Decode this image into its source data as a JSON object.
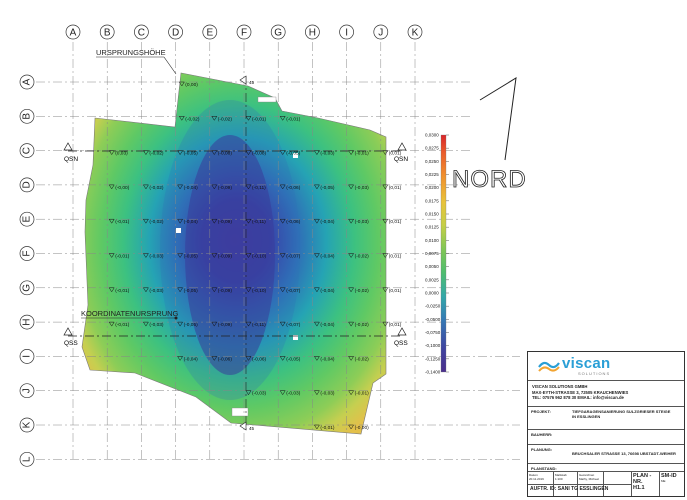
{
  "grid": {
    "columns": [
      "A",
      "B",
      "C",
      "D",
      "E",
      "F",
      "G",
      "H",
      "I",
      "J",
      "K"
    ],
    "rows": [
      "A",
      "B",
      "C",
      "D",
      "E",
      "F",
      "G",
      "H",
      "I",
      "J",
      "K",
      "L"
    ]
  },
  "labels": {
    "origin_height": "URSPRUNGSHÖHE",
    "origin_value": "(0,00)",
    "coord_origin": "KOORDINATENURSPRUNG",
    "north": "NORD",
    "section_n": "QSN",
    "section_s": "QSS",
    "section_cut": "45"
  },
  "heights": [
    {
      "v": "(0,00)",
      "c": 3.05,
      "r": 0
    },
    {
      "v": "(-0,02)",
      "c": 3.05,
      "r": 1
    },
    {
      "v": "(-0,02)",
      "c": 4,
      "r": 1
    },
    {
      "v": "(-0,01)",
      "c": 5,
      "r": 1
    },
    {
      "v": "(-0,01)",
      "c": 6,
      "r": 1
    },
    {
      "v": "(0,03)",
      "c": 1,
      "r": 2
    },
    {
      "v": "(-0,02)",
      "c": 2,
      "r": 2
    },
    {
      "v": "(-0,05)",
      "c": 3,
      "r": 2
    },
    {
      "v": "(-0,08)",
      "c": 4,
      "r": 2
    },
    {
      "v": "(-0,08)",
      "c": 5,
      "r": 2
    },
    {
      "v": "(-0,05)",
      "c": 6,
      "r": 2
    },
    {
      "v": "(-0,03)",
      "c": 7,
      "r": 2
    },
    {
      "v": "(-0,01)",
      "c": 8,
      "r": 2
    },
    {
      "v": "(0,01)",
      "c": 9,
      "r": 2
    },
    {
      "v": "(-0,00)",
      "c": 1,
      "r": 3
    },
    {
      "v": "(-0,02)",
      "c": 2,
      "r": 3
    },
    {
      "v": "(-0,04)",
      "c": 3,
      "r": 3
    },
    {
      "v": "(-0,09)",
      "c": 4,
      "r": 3
    },
    {
      "v": "(-0,11)",
      "c": 5,
      "r": 3
    },
    {
      "v": "(-0,06)",
      "c": 6,
      "r": 3
    },
    {
      "v": "(-0,05)",
      "c": 7,
      "r": 3
    },
    {
      "v": "(-0,03)",
      "c": 8,
      "r": 3
    },
    {
      "v": "(0,01)",
      "c": 9,
      "r": 3
    },
    {
      "v": "(-0,01)",
      "c": 1,
      "r": 4
    },
    {
      "v": "(-0,02)",
      "c": 2,
      "r": 4
    },
    {
      "v": "(-0,04)",
      "c": 3,
      "r": 4
    },
    {
      "v": "(-0,09)",
      "c": 4,
      "r": 4
    },
    {
      "v": "(-0,11)",
      "c": 5,
      "r": 4
    },
    {
      "v": "(-0,06)",
      "c": 6,
      "r": 4
    },
    {
      "v": "(-0,04)",
      "c": 7,
      "r": 4
    },
    {
      "v": "(-0,03)",
      "c": 8,
      "r": 4
    },
    {
      "v": "(0,01)",
      "c": 9,
      "r": 4
    },
    {
      "v": "(-0,01)",
      "c": 1,
      "r": 5
    },
    {
      "v": "(-0,03)",
      "c": 2,
      "r": 5
    },
    {
      "v": "(-0,05)",
      "c": 3,
      "r": 5
    },
    {
      "v": "(-0,09)",
      "c": 4,
      "r": 5
    },
    {
      "v": "(-0,10)",
      "c": 5,
      "r": 5
    },
    {
      "v": "(-0,07)",
      "c": 6,
      "r": 5
    },
    {
      "v": "(-0,04)",
      "c": 7,
      "r": 5
    },
    {
      "v": "(-0,02)",
      "c": 8,
      "r": 5
    },
    {
      "v": "(0,01)",
      "c": 9,
      "r": 5
    },
    {
      "v": "(-0,01)",
      "c": 1,
      "r": 6
    },
    {
      "v": "(-0,03)",
      "c": 2,
      "r": 6
    },
    {
      "v": "(-0,05)",
      "c": 3,
      "r": 6
    },
    {
      "v": "(-0,09)",
      "c": 4,
      "r": 6
    },
    {
      "v": "(-0,10)",
      "c": 5,
      "r": 6
    },
    {
      "v": "(-0,07)",
      "c": 6,
      "r": 6
    },
    {
      "v": "(-0,04)",
      "c": 7,
      "r": 6
    },
    {
      "v": "(-0,02)",
      "c": 8,
      "r": 6
    },
    {
      "v": "(0,01)",
      "c": 9,
      "r": 6
    },
    {
      "v": "(-0,01)",
      "c": 1,
      "r": 7
    },
    {
      "v": "(-0,03)",
      "c": 2,
      "r": 7
    },
    {
      "v": "(-0,05)",
      "c": 3,
      "r": 7
    },
    {
      "v": "(-0,09)",
      "c": 4,
      "r": 7
    },
    {
      "v": "(-0,11)",
      "c": 5,
      "r": 7
    },
    {
      "v": "(-0,07)",
      "c": 6,
      "r": 7
    },
    {
      "v": "(-0,04)",
      "c": 7,
      "r": 7
    },
    {
      "v": "(-0,02)",
      "c": 8,
      "r": 7
    },
    {
      "v": "(0,01)",
      "c": 9,
      "r": 7
    },
    {
      "v": "(-0,04)",
      "c": 3,
      "r": 8
    },
    {
      "v": "(-0,06)",
      "c": 4,
      "r": 8
    },
    {
      "v": "(-0,06)",
      "c": 5,
      "r": 8
    },
    {
      "v": "(-0,05)",
      "c": 6,
      "r": 8
    },
    {
      "v": "(-0,04)",
      "c": 7,
      "r": 8
    },
    {
      "v": "(-0,02)",
      "c": 8,
      "r": 8
    },
    {
      "v": "(-0,03)",
      "c": 5,
      "r": 9
    },
    {
      "v": "(-0,03)",
      "c": 6,
      "r": 9
    },
    {
      "v": "(-0,03)",
      "c": 7,
      "r": 9
    },
    {
      "v": "(-0,01)",
      "c": 8,
      "r": 9
    },
    {
      "v": "(-0,01)",
      "c": 7,
      "r": 10
    },
    {
      "v": "(-0,00)",
      "c": 8,
      "r": 10
    }
  ],
  "legend": {
    "ticks": [
      "0,0300",
      "0,0275",
      "0,0250",
      "0,0225",
      "0,0200",
      "0,0175",
      "0,0150",
      "0,0125",
      "0,0100",
      "0,0075",
      "0,0050",
      "0,0025",
      "0,0000",
      "-0,0250",
      "-0,0500",
      "-0,0750",
      "-0,1000",
      "-0,1250",
      "-0,1400"
    ]
  },
  "title_block": {
    "company_name": "viscan",
    "company_tag": "SOLUTIONS",
    "addr1": "VISCAN SOLUTIONS GMBH",
    "addr2": "MAX-EYTH-STRASSE 3, 72505 KRAUCHENWIES",
    "addr3": "TEL: 07576 962 878 30  EMAIL: info@viscan.de",
    "projekt_label": "PROJEKT:",
    "projekt_value1": "TIEFGARAGENSANIERUNG SULZGRIESER STEIGE",
    "projekt_value2": "IN ESSLINGEN",
    "bauherr_label": "BAUHERR:",
    "planung_label": "PLANUNG:",
    "planung_value": "BRUCHSALER STRASSE 13, 76698 UBSTADT-WEIHER",
    "planstand_label": "PLANSTAND:",
    "datum_label": "Datum",
    "datum_value": "20.11.2019",
    "massstab_label": "Maßstab",
    "massstab_value": "1:100",
    "gezeichnet_label": "Gezeichnet",
    "gezeichnet_value": "Mathy, Micheel",
    "auftrag": "AUFTR. ID: SANI TG ESSLINGEN",
    "plan_nr_label": "PLAN - NR.",
    "plan_nr_value": "H1.1",
    "plan_code": "SM-ID",
    "sheet": "ME"
  }
}
